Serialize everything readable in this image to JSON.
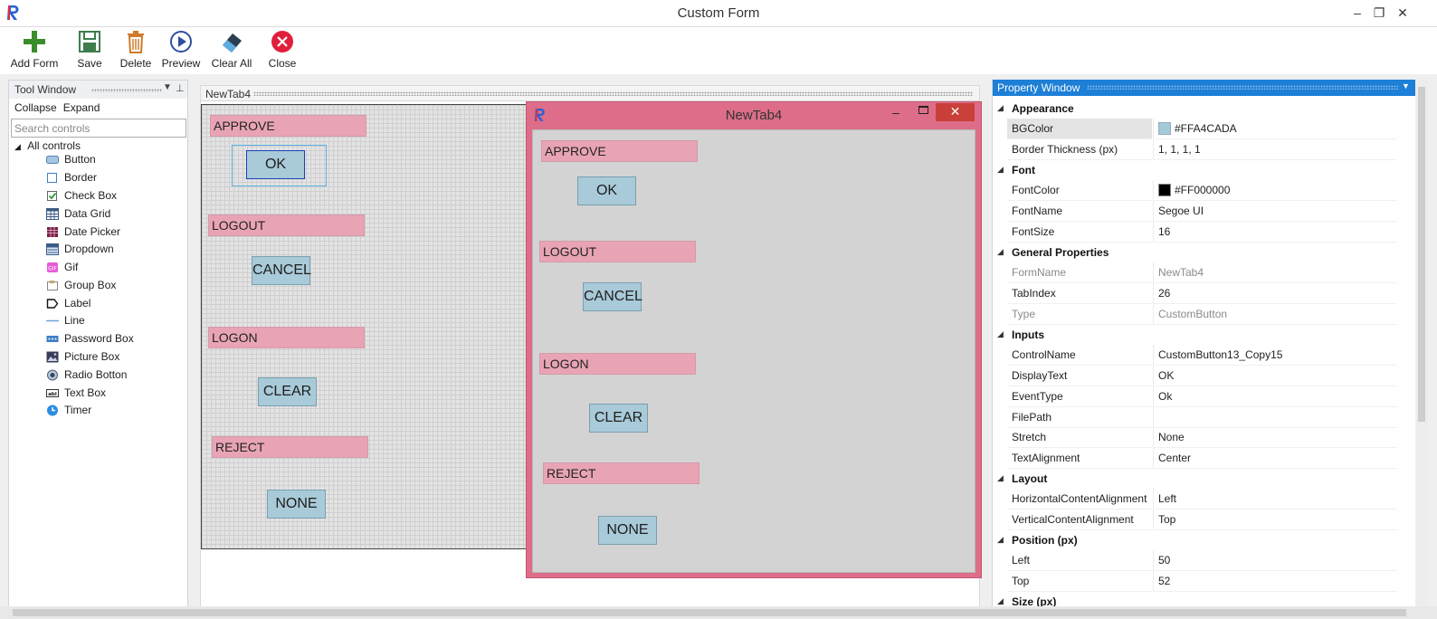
{
  "window": {
    "title": "Custom Form",
    "minimize": "–",
    "restore": "❐",
    "close": "✕"
  },
  "toolbar": {
    "add_form": "Add Form",
    "save": "Save",
    "delete": "Delete",
    "preview": "Preview",
    "clear_all": "Clear All",
    "close": "Close"
  },
  "tool_window": {
    "title": "Tool Window",
    "collapse": "Collapse",
    "expand": "Expand",
    "search_placeholder": "Search controls",
    "root": "All controls",
    "items": [
      {
        "label": "Button",
        "icon": "button-icon"
      },
      {
        "label": "Border",
        "icon": "border-icon"
      },
      {
        "label": "Check Box",
        "icon": "checkbox-icon"
      },
      {
        "label": "Data Grid",
        "icon": "datagrid-icon"
      },
      {
        "label": "Date Picker",
        "icon": "datepicker-icon"
      },
      {
        "label": "Dropdown",
        "icon": "dropdown-icon"
      },
      {
        "label": "Gif",
        "icon": "gif-icon"
      },
      {
        "label": "Group Box",
        "icon": "groupbox-icon"
      },
      {
        "label": "Label",
        "icon": "label-icon"
      },
      {
        "label": "Line",
        "icon": "line-icon"
      },
      {
        "label": "Password Box",
        "icon": "passwordbox-icon"
      },
      {
        "label": "Picture Box",
        "icon": "picturebox-icon"
      },
      {
        "label": "Radio Botton",
        "icon": "radio-icon"
      },
      {
        "label": "Text Box",
        "icon": "textbox-icon"
      },
      {
        "label": "Timer",
        "icon": "timer-icon"
      }
    ]
  },
  "designer": {
    "tab": "NewTab4",
    "labels": [
      "APPROVE",
      "LOGOUT",
      "LOGON",
      "REJECT"
    ],
    "buttons": [
      "OK",
      "CANCEL",
      "CLEAR",
      "NONE"
    ]
  },
  "preview": {
    "title": "NewTab4",
    "labels": [
      "APPROVE",
      "LOGOUT",
      "LOGON",
      "REJECT"
    ],
    "buttons": [
      "OK",
      "CANCEL",
      "CLEAR",
      "NONE"
    ]
  },
  "property_window": {
    "title": "Property Window",
    "categories": {
      "appearance": "Appearance",
      "font": "Font",
      "general": "General Properties",
      "inputs": "Inputs",
      "layout": "Layout",
      "position": "Position (px)",
      "size": "Size (px)"
    },
    "rows": {
      "bgcolor": {
        "k": "BGColor",
        "v": "#FFA4CADA"
      },
      "border": {
        "k": "Border Thickness (px)",
        "v": "1, 1, 1, 1"
      },
      "fontcolor": {
        "k": "FontColor",
        "v": "#FF000000"
      },
      "fontname": {
        "k": "FontName",
        "v": "Segoe UI"
      },
      "fontsize": {
        "k": "FontSize",
        "v": "16"
      },
      "formname": {
        "k": "FormName",
        "v": "NewTab4"
      },
      "tabindex": {
        "k": "TabIndex",
        "v": "26"
      },
      "type": {
        "k": "Type",
        "v": "CustomButton"
      },
      "controlname": {
        "k": "ControlName",
        "v": "CustomButton13_Copy15"
      },
      "displaytext": {
        "k": "DisplayText",
        "v": "OK"
      },
      "eventtype": {
        "k": "EventType",
        "v": "Ok"
      },
      "filepath": {
        "k": "FilePath",
        "v": ""
      },
      "stretch": {
        "k": "Stretch",
        "v": "None"
      },
      "textalign": {
        "k": "TextAlignment",
        "v": "Center"
      },
      "hca": {
        "k": "HorizontalContentAlignment",
        "v": "Left"
      },
      "vca": {
        "k": "VerticalContentAlignment",
        "v": "Top"
      },
      "left": {
        "k": "Left",
        "v": "50"
      },
      "top": {
        "k": "Top",
        "v": "52"
      }
    }
  },
  "colors": {
    "label_pink": "#e8a4b5",
    "button_blue": "#a9cad8",
    "preview_frame": "#dd6d88",
    "accent": "#1d7fd6",
    "bg_swatch": "#a4cada",
    "font_swatch": "#000000"
  }
}
